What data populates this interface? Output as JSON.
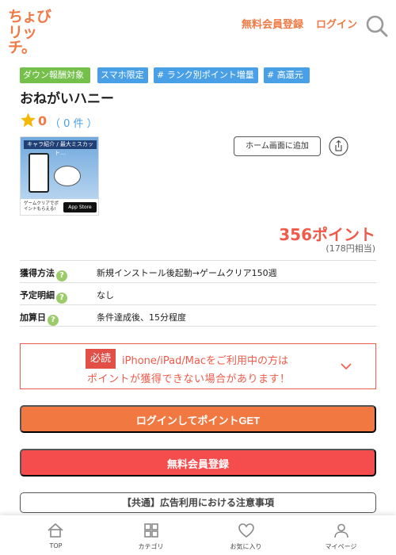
{
  "header": {
    "logo_line1": "ちょび",
    "logo_line2": "リッチ。",
    "register_label": "無料会員登録",
    "login_label": "ログイン"
  },
  "tags": [
    "ダウン報酬対象",
    "スマホ限定",
    "# ランク別ポイント増量",
    "# 高還元"
  ],
  "offer": {
    "title": "おねがいハニー",
    "rating": "0",
    "review_count": "（ 0 件 ）",
    "thumbnail": {
      "banner": "キャラ紹介 / 最大ミスカット…",
      "caption": "ゲームクリアでポイントもらえる!",
      "store_label": "App Store"
    },
    "home_button_label": "ホーム画面に追加",
    "points": "356ポイント",
    "points_sub": "(178円相当)"
  },
  "info_rows": [
    {
      "label": "獲得方法",
      "value": "新規インストール後起動→ゲームクリア150週"
    },
    {
      "label": "予定明細",
      "value": "なし"
    },
    {
      "label": "加算日",
      "value": "条件達成後、15分程度"
    }
  ],
  "notice": {
    "badge": "必読",
    "line1": "iPhone/iPad/Macをご利用中の方は",
    "line2": "ポイントが獲得できない場合があります！"
  },
  "buttons": {
    "login_get": "ログインしてポイントGET",
    "register": "無料会員登録",
    "caution": "【共通】広告利用における注意事項"
  },
  "bottom_nav": [
    {
      "label": "TOP",
      "icon": "home-icon"
    },
    {
      "label": "カテゴリ",
      "icon": "category-icon"
    },
    {
      "label": "お気に入り",
      "icon": "heart-icon"
    },
    {
      "label": "マイページ",
      "icon": "user-icon"
    }
  ],
  "colors": {
    "brand_orange": "#ef7a45",
    "points_red": "#ef5a4a",
    "tag_green": "#74c04b",
    "tag_blue": "#4aa0e6"
  }
}
